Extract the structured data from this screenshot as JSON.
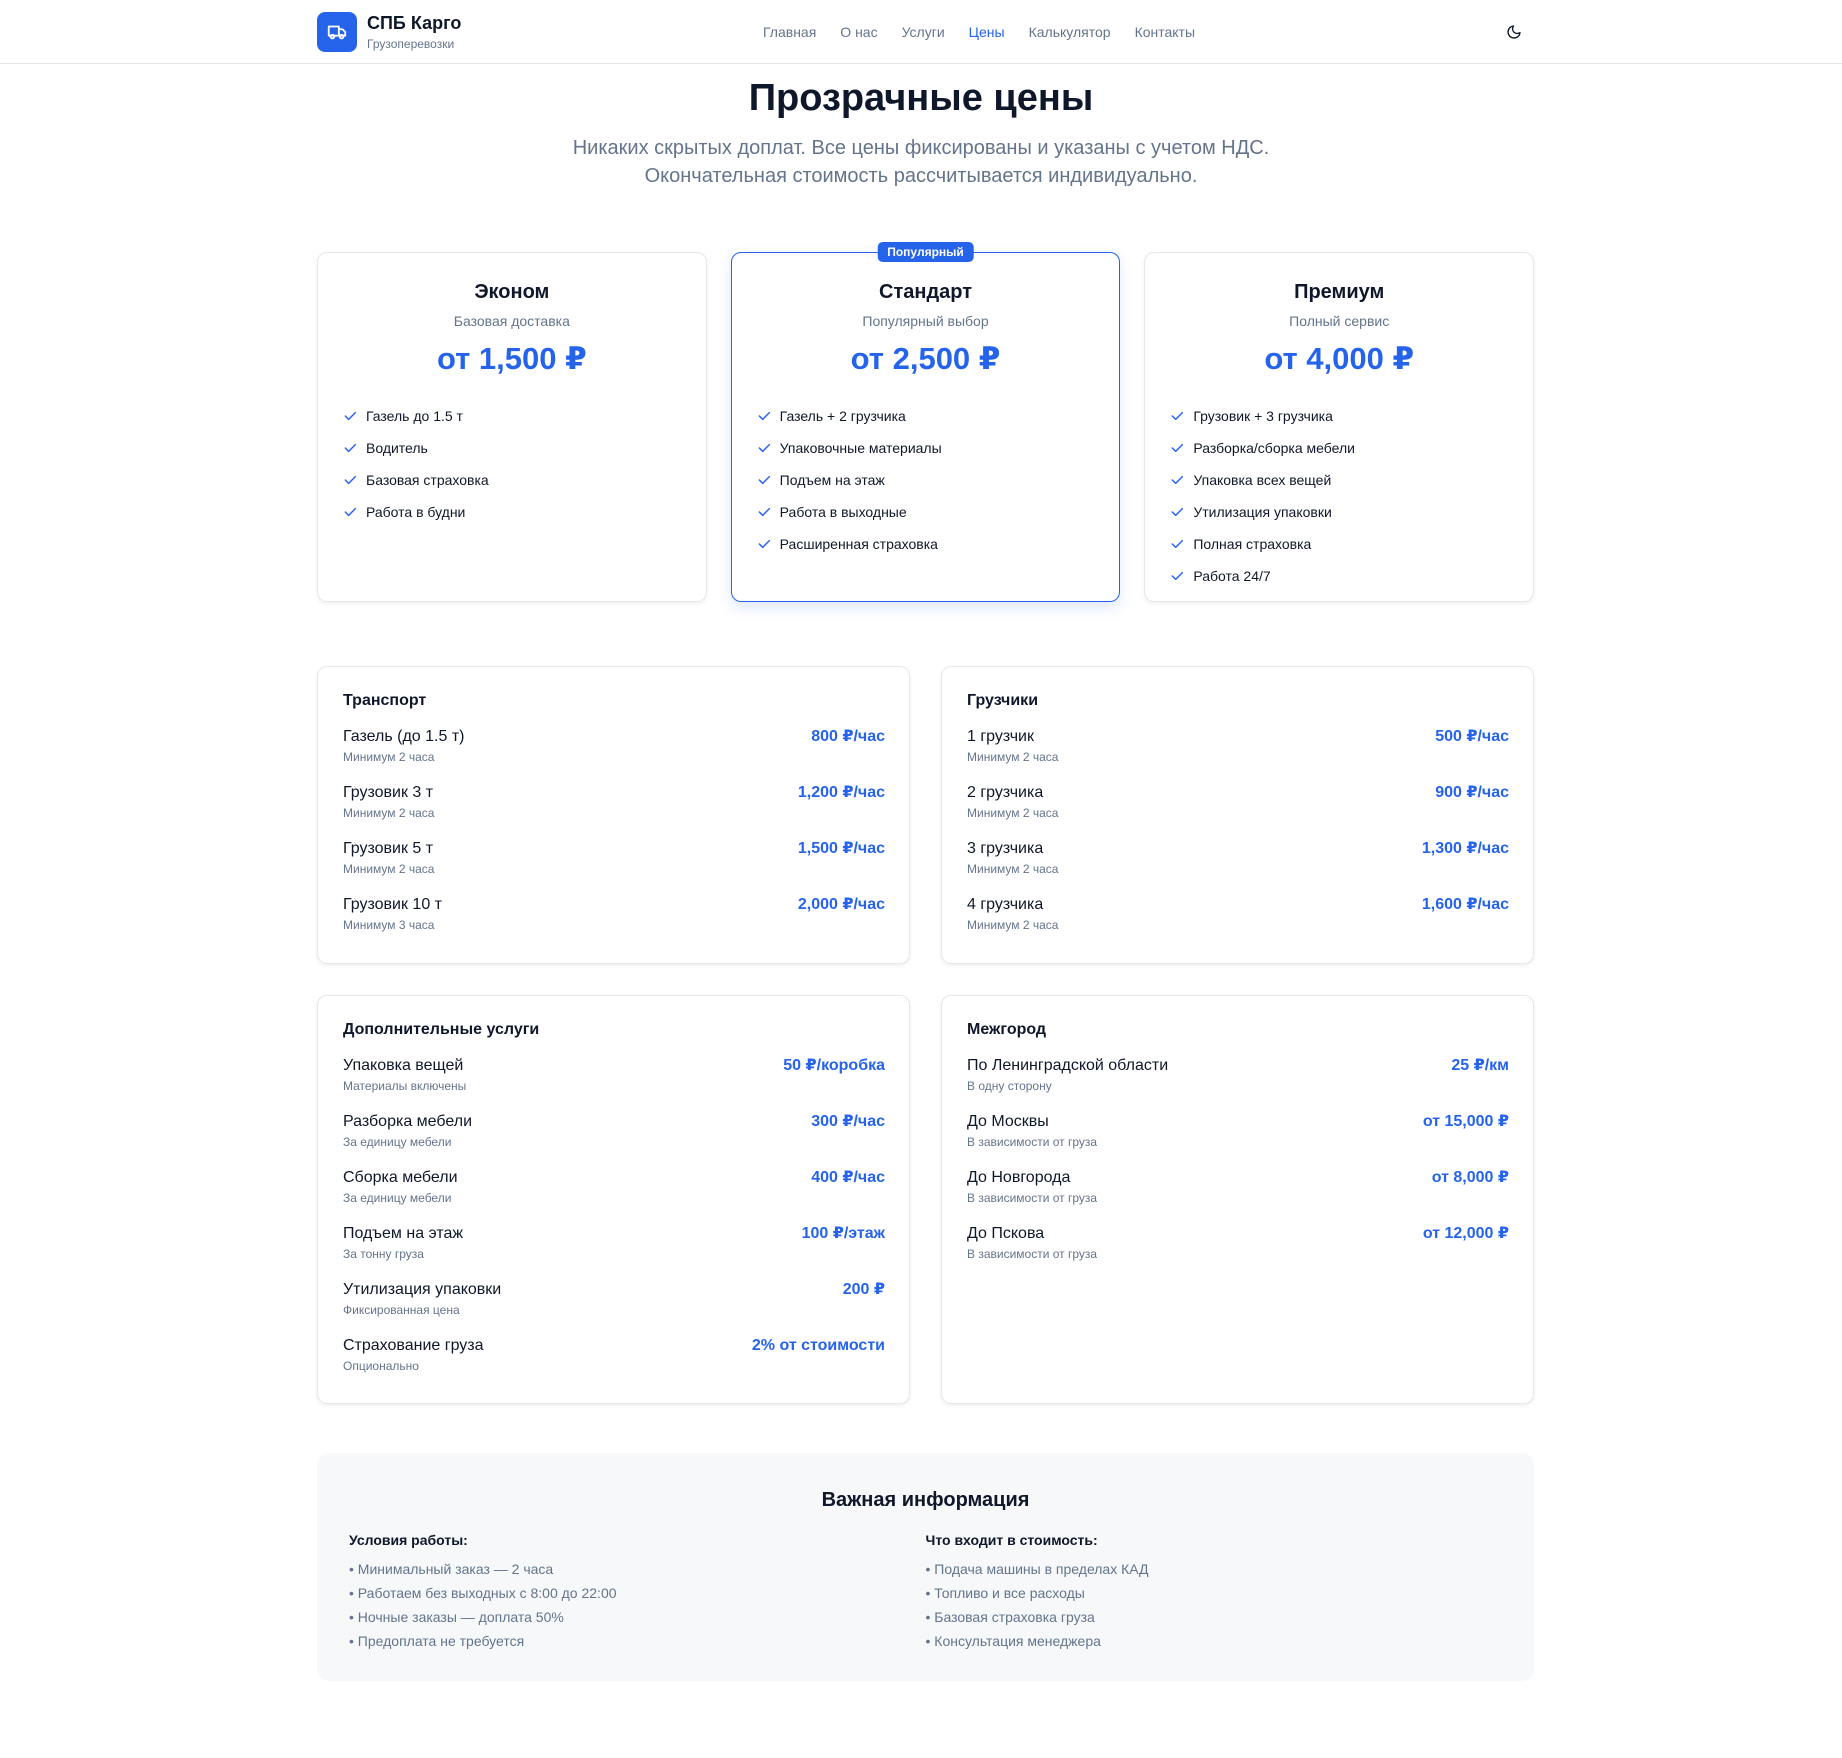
{
  "header": {
    "brand_name": "СПБ Карго",
    "brand_sub": "Грузоперевозки",
    "logo_icon": "truck-icon",
    "nav": [
      {
        "label": "Главная",
        "active": false
      },
      {
        "label": "О нас",
        "active": false
      },
      {
        "label": "Услуги",
        "active": false
      },
      {
        "label": "Цены",
        "active": true
      },
      {
        "label": "Калькулятор",
        "active": false
      },
      {
        "label": "Контакты",
        "active": false
      }
    ],
    "theme_icon": "moon-icon"
  },
  "hero": {
    "title": "Прозрачные цены",
    "subtitle_line1": "Никаких скрытых доплат. Все цены фиксированы и указаны с учетом НДС.",
    "subtitle_line2": "Окончательная стоимость рассчитывается индивидуально."
  },
  "plans": [
    {
      "name": "Эконом",
      "desc": "Базовая доставка",
      "price": "от 1,500 ₽",
      "features": [
        "Газель до 1.5 т",
        "Водитель",
        "Базовая страховка",
        "Работа в будни"
      ]
    },
    {
      "name": "Стандарт",
      "desc": "Популярный выбор",
      "price": "от 2,500 ₽",
      "badge": "Популярный",
      "features": [
        "Газель + 2 грузчика",
        "Упаковочные материалы",
        "Подъем на этаж",
        "Работа в выходные",
        "Расширенная страховка"
      ]
    },
    {
      "name": "Премиум",
      "desc": "Полный сервис",
      "price": "от 4,000 ₽",
      "features": [
        "Грузовик + 3 грузчика",
        "Разборка/сборка мебели",
        "Упаковка всех вещей",
        "Утилизация упаковки",
        "Полная страховка",
        "Работа 24/7"
      ]
    }
  ],
  "tables": [
    {
      "title": "Транспорт",
      "rows": [
        {
          "name": "Газель (до 1.5 т)",
          "note": "Минимум 2 часа",
          "price": "800 ₽/час"
        },
        {
          "name": "Грузовик 3 т",
          "note": "Минимум 2 часа",
          "price": "1,200 ₽/час"
        },
        {
          "name": "Грузовик 5 т",
          "note": "Минимум 2 часа",
          "price": "1,500 ₽/час"
        },
        {
          "name": "Грузовик 10 т",
          "note": "Минимум 3 часа",
          "price": "2,000 ₽/час"
        }
      ]
    },
    {
      "title": "Грузчики",
      "rows": [
        {
          "name": "1 грузчик",
          "note": "Минимум 2 часа",
          "price": "500 ₽/час"
        },
        {
          "name": "2 грузчика",
          "note": "Минимум 2 часа",
          "price": "900 ₽/час"
        },
        {
          "name": "3 грузчика",
          "note": "Минимум 2 часа",
          "price": "1,300 ₽/час"
        },
        {
          "name": "4 грузчика",
          "note": "Минимум 2 часа",
          "price": "1,600 ₽/час"
        }
      ]
    },
    {
      "title": "Дополнительные услуги",
      "rows": [
        {
          "name": "Упаковка вещей",
          "note": "Материалы включены",
          "price": "50 ₽/коробка"
        },
        {
          "name": "Разборка мебели",
          "note": "За единицу мебели",
          "price": "300 ₽/час"
        },
        {
          "name": "Сборка мебели",
          "note": "За единицу мебели",
          "price": "400 ₽/час"
        },
        {
          "name": "Подъем на этаж",
          "note": "За тонну груза",
          "price": "100 ₽/этаж"
        },
        {
          "name": "Утилизация упаковки",
          "note": "Фиксированная цена",
          "price": "200 ₽"
        },
        {
          "name": "Страхование груза",
          "note": "Опционально",
          "price": "2% от стоимости"
        }
      ]
    },
    {
      "title": "Межгород",
      "rows": [
        {
          "name": "По Ленинградской области",
          "note": "В одну сторону",
          "price": "25 ₽/км"
        },
        {
          "name": "До Москвы",
          "note": "В зависимости от груза",
          "price": "от 15,000 ₽"
        },
        {
          "name": "До Новгорода",
          "note": "В зависимости от груза",
          "price": "от 8,000 ₽"
        },
        {
          "name": "До Пскова",
          "note": "В зависимости от груза",
          "price": "от 12,000 ₽"
        }
      ]
    }
  ],
  "info": {
    "title": "Важная информация",
    "left_title": "Условия работы:",
    "left_items": [
      "• Минимальный заказ — 2 часа",
      "• Работаем без выходных с 8:00 до 22:00",
      "• Ночные заказы — доплата 50%",
      "• Предоплата не требуется"
    ],
    "right_title": "Что входит в стоимость:",
    "right_items": [
      "• Подача машины в пределах КАД",
      "• Топливо и все расходы",
      "• Базовая страховка груза",
      "• Консультация менеджера"
    ]
  },
  "colors": {
    "accent": "#2563eb",
    "text": "#0f172a",
    "muted": "#64748b",
    "border": "#e5e7eb",
    "info_bg": "#f6f8fa"
  }
}
